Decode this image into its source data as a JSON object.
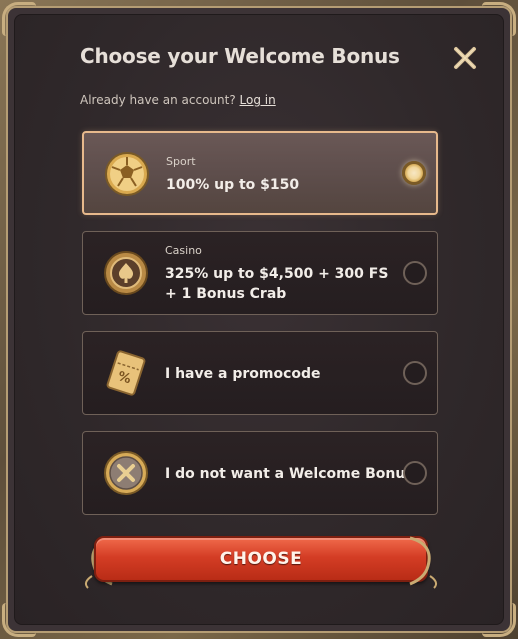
{
  "dialog": {
    "title": "Choose your Welcome Bonus",
    "account_text": "Already have an account?",
    "login_label": "Log in",
    "choose_label": "CHOOSE"
  },
  "options": [
    {
      "category": "Sport",
      "label": "100% up to $150",
      "icon": "soccer-ball-icon",
      "selected": true
    },
    {
      "category": "Casino",
      "label": "325% up to $4,500 + 300 FS + 1 Bonus Crab",
      "icon": "casino-chip-icon",
      "selected": false
    },
    {
      "category": "",
      "label": "I have a promocode",
      "icon": "promo-ticket-icon",
      "selected": false
    },
    {
      "category": "",
      "label": "I do not want a Welcome Bonus",
      "icon": "no-bonus-icon",
      "selected": false
    }
  ],
  "colors": {
    "accent_gold": "#e7b98c",
    "button_red": "#d43d25",
    "panel_bg": "#2f282a"
  }
}
